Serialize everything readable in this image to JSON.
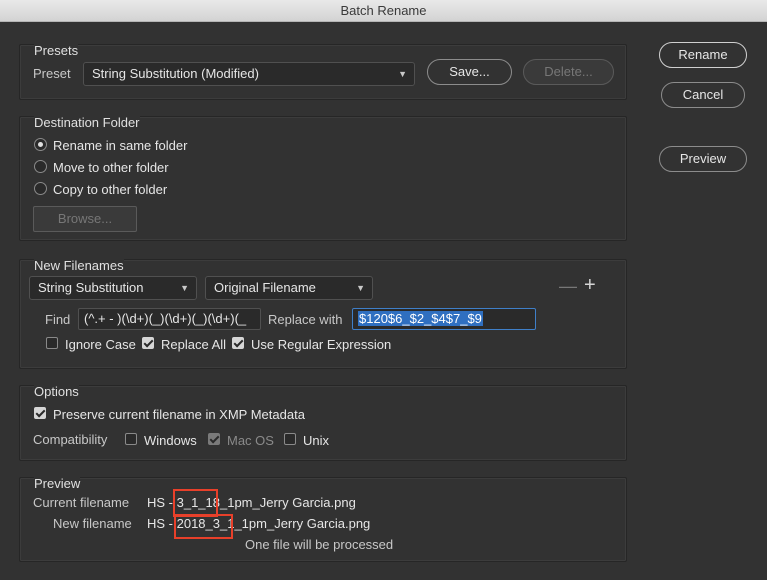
{
  "window": {
    "title": "Batch Rename"
  },
  "buttons": {
    "rename": "Rename",
    "cancel": "Cancel",
    "preview": "Preview"
  },
  "presets": {
    "title": "Presets",
    "label": "Preset",
    "selected": "String Substitution (Modified)",
    "save": "Save...",
    "delete": "Delete..."
  },
  "destination": {
    "title": "Destination Folder",
    "options": [
      "Rename in same folder",
      "Move to other folder",
      "Copy to other folder"
    ],
    "selected_index": 0,
    "browse": "Browse..."
  },
  "new_filenames": {
    "title": "New Filenames",
    "type_select": "String Substitution",
    "source_select": "Original Filename",
    "minus": "—",
    "plus": "+",
    "find_label": "Find",
    "find_value": "(^.+ - )(\\d+)(_)(\\d+)(_)(\\d+)(_",
    "replace_label": "Replace with",
    "replace_value": "$120$6_$2_$4$7_$9",
    "ignore_case": {
      "label": "Ignore Case",
      "checked": false
    },
    "replace_all": {
      "label": "Replace All",
      "checked": true
    },
    "use_regex": {
      "label": "Use Regular Expression",
      "checked": true
    }
  },
  "options": {
    "title": "Options",
    "preserve": {
      "label": "Preserve current filename in XMP Metadata",
      "checked": true
    },
    "compat_label": "Compatibility",
    "windows": {
      "label": "Windows",
      "checked": false
    },
    "macos": {
      "label": "Mac OS",
      "checked": true,
      "disabled": true
    },
    "unix": {
      "label": "Unix",
      "checked": false
    }
  },
  "preview": {
    "title": "Preview",
    "current_label": "Current filename",
    "current_value": "HS - 3_1_18_1pm_Jerry Garcia.png",
    "new_label": "New filename",
    "new_value": "HS - 2018_3_1_1pm_Jerry Garcia.png",
    "status": "One file will be processed"
  },
  "colors": {
    "background": "#323232",
    "highlight": "#2f6fc0",
    "annotation": "#e8402a"
  }
}
